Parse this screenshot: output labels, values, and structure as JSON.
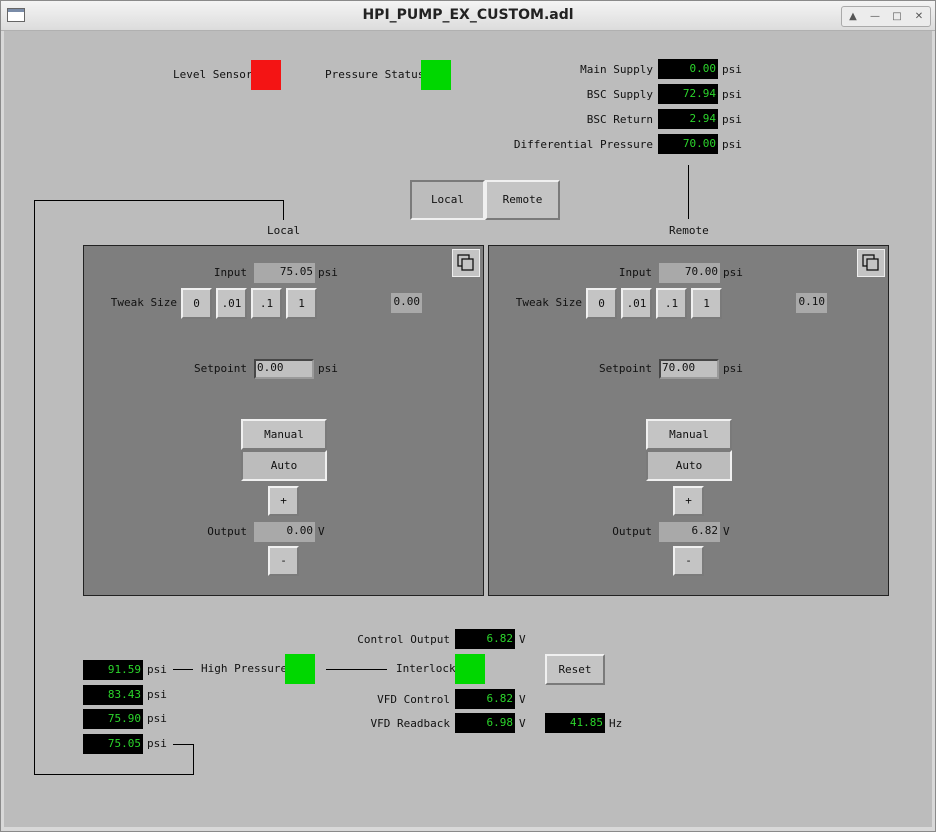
{
  "window": {
    "title": "HPI_PUMP_EX_CUSTOM.adl"
  },
  "colors": {
    "alarm_red": "#f41414",
    "ok_green": "#00d700",
    "display_green": "#2bd52b"
  },
  "top_status": {
    "level_sensor_label": "Level Sensor",
    "pressure_status_label": "Pressure Status",
    "level_sensor_color": "red",
    "pressure_status_color": "green"
  },
  "supply_readings": [
    {
      "label": "Main Supply",
      "value": "0.00",
      "unit": "psi"
    },
    {
      "label": "BSC Supply",
      "value": "72.94",
      "unit": "psi"
    },
    {
      "label": "BSC Return",
      "value": "2.94",
      "unit": "psi"
    },
    {
      "label": "Differential Pressure",
      "value": "70.00",
      "unit": "psi"
    }
  ],
  "mode": {
    "local_label": "Local",
    "remote_label": "Remote",
    "active": "Local"
  },
  "panels": [
    {
      "heading": "Local",
      "input_label": "Input",
      "input_value": "75.05",
      "input_unit": "psi",
      "tweak_label": "Tweak Size",
      "tweak_buttons": [
        "0",
        ".01",
        ".1",
        "1"
      ],
      "tweak_value": "0.00",
      "setpoint_label": "Setpoint",
      "setpoint_value": "0.00",
      "setpoint_unit": "psi",
      "manual_label": "Manual",
      "auto_label": "Auto",
      "active_mode": "Auto",
      "plus_label": "+",
      "minus_label": "-",
      "output_label": "Output",
      "output_value": "0.00",
      "output_unit": "V"
    },
    {
      "heading": "Remote",
      "input_label": "Input",
      "input_value": "70.00",
      "input_unit": "psi",
      "tweak_label": "Tweak Size",
      "tweak_buttons": [
        "0",
        ".01",
        ".1",
        "1"
      ],
      "tweak_value": "0.10",
      "setpoint_label": "Setpoint",
      "setpoint_value": "70.00",
      "setpoint_unit": "psi",
      "manual_label": "Manual",
      "auto_label": "Auto",
      "active_mode": "Auto",
      "plus_label": "+",
      "minus_label": "-",
      "output_label": "Output",
      "output_value": "6.82",
      "output_unit": "V"
    }
  ],
  "pressure_list": [
    {
      "value": "91.59",
      "unit": "psi"
    },
    {
      "value": "83.43",
      "unit": "psi"
    },
    {
      "value": "75.90",
      "unit": "psi"
    },
    {
      "value": "75.05",
      "unit": "psi"
    }
  ],
  "bottom": {
    "high_pressure_label": "High Pressure",
    "interlock_label": "Interlock",
    "control_output_label": "Control Output",
    "control_output_value": "6.82",
    "control_output_unit": "V",
    "vfd_control_label": "VFD Control",
    "vfd_control_value": "6.82",
    "vfd_control_unit": "V",
    "vfd_readback_label": "VFD Readback",
    "vfd_readback_value": "6.98",
    "vfd_readback_unit": "V",
    "frequency_value": "41.85",
    "frequency_unit": "Hz",
    "reset_label": "Reset"
  }
}
